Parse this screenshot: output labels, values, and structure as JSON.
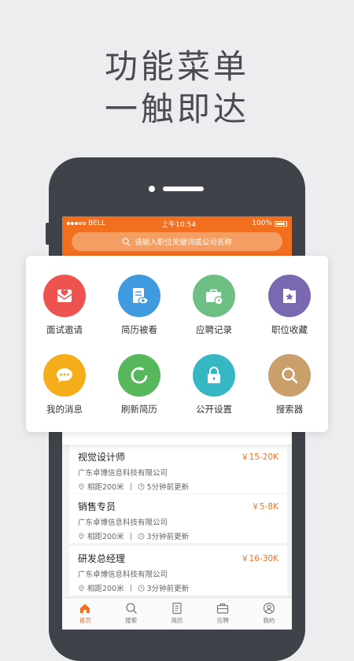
{
  "headline": {
    "line1": "功能菜单",
    "line2": "一触即达"
  },
  "status_bar": {
    "carrier": "BELL",
    "time": "上午10:54",
    "battery": "100%"
  },
  "search": {
    "placeholder": "请输入职位关键词或公司名称",
    "icon": "search-icon"
  },
  "menu": {
    "items": [
      {
        "label": "面试邀请",
        "icon": "invitation-heart-icon",
        "color": "#ef5350"
      },
      {
        "label": "简历被看",
        "icon": "resume-viewed-icon",
        "color": "#3f9ae0"
      },
      {
        "label": "应聘记录",
        "icon": "briefcase-clock-icon",
        "color": "#6dbf83"
      },
      {
        "label": "职位收藏",
        "icon": "bookmark-star-icon",
        "color": "#7b68b3"
      },
      {
        "label": "我的消息",
        "icon": "chat-bubble-icon",
        "color": "#f5ad1c"
      },
      {
        "label": "刷新简历",
        "icon": "refresh-icon",
        "color": "#56b85a"
      },
      {
        "label": "公开设置",
        "icon": "lock-icon",
        "color": "#36b7c4"
      },
      {
        "label": "搜索器",
        "icon": "search-icon",
        "color": "#c9a06c"
      }
    ]
  },
  "jobs": [
    {
      "title": "视觉设计师",
      "salary": "￥15-20K",
      "company": "广东卓博信息科技有限公司",
      "distance": "相距200米",
      "updated": "5分钟前更新"
    },
    {
      "title": "销售专员",
      "salary": "￥5-8K",
      "company": "广东卓博信息科技有限公司",
      "distance": "相距200米",
      "updated": "3分钟前更新"
    },
    {
      "title": "研发总经理",
      "salary": "￥16-30K",
      "company": "广东卓博信息科技有限公司",
      "distance": "相距200米",
      "updated": "3分钟前更新"
    }
  ],
  "tabbar": {
    "items": [
      {
        "label": "首页",
        "icon": "home-icon",
        "active": true
      },
      {
        "label": "搜索",
        "icon": "search-icon",
        "active": false
      },
      {
        "label": "简历",
        "icon": "resume-icon",
        "active": false
      },
      {
        "label": "应聘",
        "icon": "briefcase-icon",
        "active": false
      },
      {
        "label": "我的",
        "icon": "user-icon",
        "active": false
      }
    ]
  },
  "colors": {
    "brand_orange": "#f26f1f",
    "phone_body": "#3f4249",
    "background": "#ecedef"
  }
}
